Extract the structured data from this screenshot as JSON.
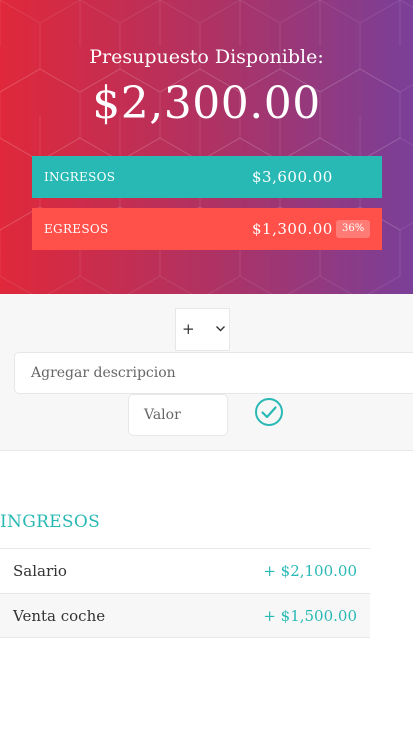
{
  "budget": {
    "title": "Presupuesto Disponible:",
    "value": "$2,300.00"
  },
  "summary": {
    "income": {
      "label": "INGRESOS",
      "value": "$3,600.00",
      "color": "#28b9b5"
    },
    "expense": {
      "label": "EGRESOS",
      "value": "$1,300.00",
      "percentage": "36%",
      "color": "#ff5049"
    }
  },
  "add_form": {
    "type_selected": "+",
    "description_placeholder": "Agregar descripcion",
    "value_placeholder": "Valor",
    "submit_icon": "check-circle-icon"
  },
  "income_list": {
    "title": "INGRESOS",
    "items": [
      {
        "description": "Salario",
        "value": "+ $2,100.00"
      },
      {
        "description": "Venta coche",
        "value": "+ $1,500.00"
      }
    ]
  }
}
